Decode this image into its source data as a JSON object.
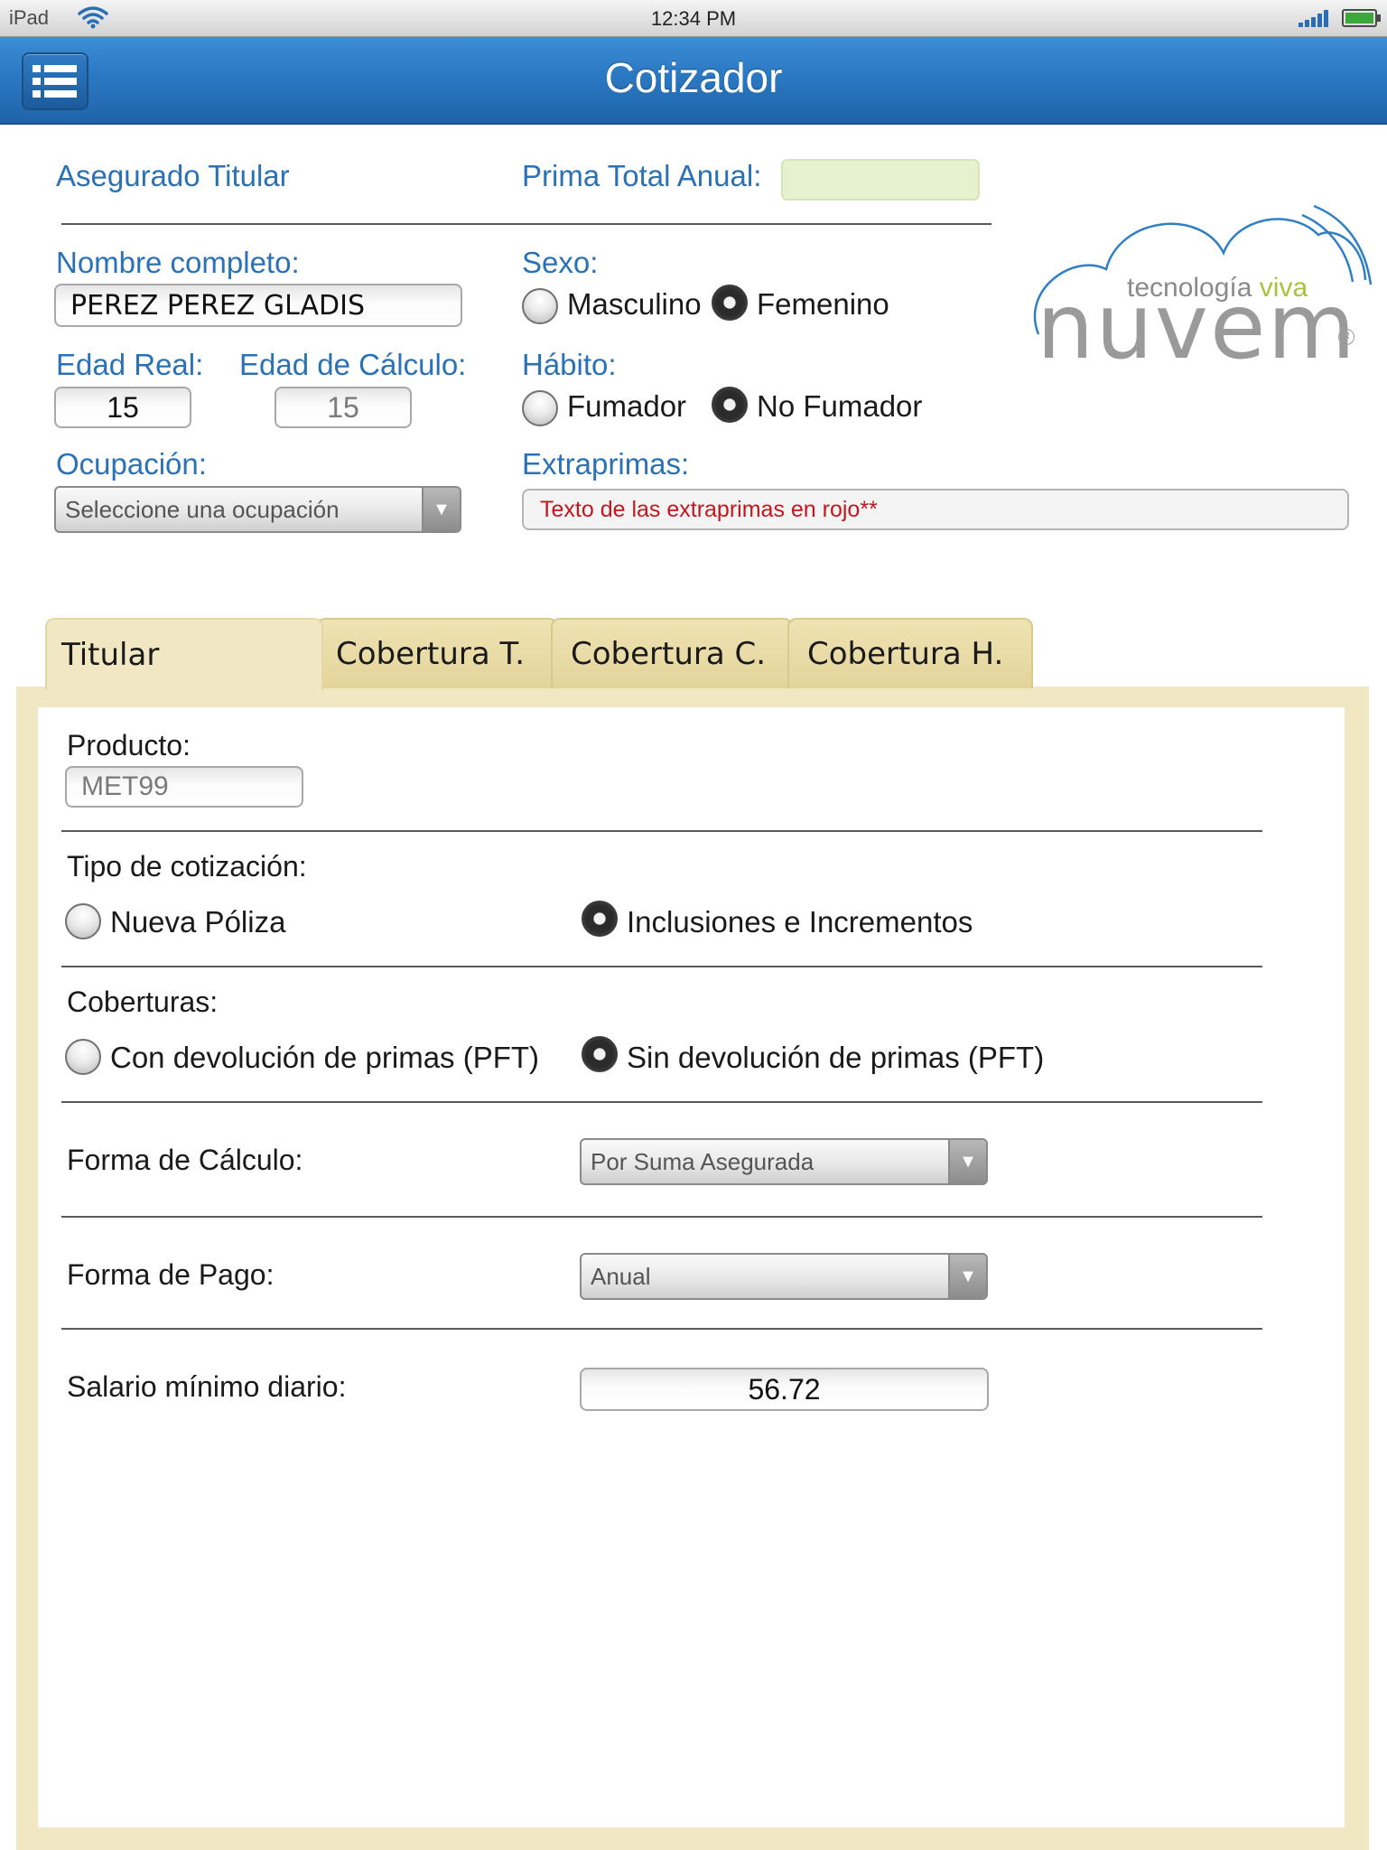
{
  "status_bar": {
    "device": "iPad",
    "time": "12:34 PM",
    "icons": [
      "wifi-icon",
      "signal-icon",
      "battery-icon"
    ]
  },
  "nav": {
    "title": "Cotizador",
    "menu_icon": "list-menu-icon"
  },
  "header": {
    "asegurado_titular": "Asegurado Titular",
    "prima_total_label": "Prima Total Anual:",
    "prima_total_value": "",
    "nombre_label": "Nombre completo:",
    "nombre_value": "PEREZ PEREZ GLADIS",
    "edad_real_label": "Edad Real:",
    "edad_real_value": "15",
    "edad_calculo_label": "Edad de Cálculo:",
    "edad_calculo_value": "15",
    "ocupacion_label": "Ocupación:",
    "ocupacion_value": "Seleccione una ocupación",
    "sexo_label": "Sexo:",
    "sexo_options": [
      {
        "label": "Masculino",
        "selected": false
      },
      {
        "label": "Femenino",
        "selected": true
      }
    ],
    "habito_label": "Hábito:",
    "habito_options": [
      {
        "label": "Fumador",
        "selected": false
      },
      {
        "label": "No Fumador",
        "selected": true
      }
    ],
    "extraprimas_label": "Extraprimas:",
    "extraprimas_value": "Texto de las extraprimas en rojo**"
  },
  "logo": {
    "tagline_1": "tecnología",
    "tagline_2": "viva",
    "name": "nuvem",
    "registered": "R"
  },
  "tabs": [
    {
      "label": "Titular",
      "active": true
    },
    {
      "label": "Cobertura T.",
      "active": false
    },
    {
      "label": "Cobertura C.",
      "active": false
    },
    {
      "label": "Cobertura H.",
      "active": false
    }
  ],
  "panel": {
    "producto_label": "Producto:",
    "producto_value": "MET99",
    "tipo_label": "Tipo de cotización:",
    "tipo_options": [
      {
        "label": "Nueva Póliza",
        "selected": false
      },
      {
        "label": "Inclusiones e Incrementos",
        "selected": true
      }
    ],
    "coberturas_label": "Coberturas:",
    "coberturas_options": [
      {
        "label": "Con devolución de primas (PFT)",
        "selected": false
      },
      {
        "label": "Sin devolución de primas (PFT)",
        "selected": true
      }
    ],
    "forma_calculo_label": "Forma de Cálculo:",
    "forma_calculo_value": "Por Suma Asegurada",
    "forma_pago_label": "Forma de Pago:",
    "forma_pago_value": "Anual",
    "salario_label": "Salario mínimo diario:",
    "salario_value": "56.72"
  },
  "colors": {
    "nav_blue": "#2b78c2",
    "label_blue": "#2a72b5",
    "tab_beige": "#f1e8c3",
    "prima_field_green": "#e6f1cf",
    "extraprimas_red": "#c4161c",
    "logo_gray": "#9a9a9a",
    "logo_green": "#a9c23f"
  }
}
